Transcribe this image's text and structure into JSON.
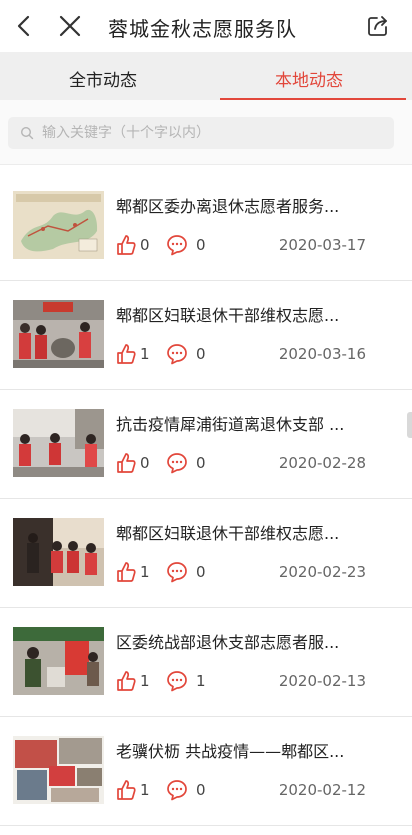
{
  "header": {
    "title": "蓉城金秋志愿服务队",
    "icons": {
      "back": "chevron-left-icon",
      "close": "close-icon",
      "share": "share-icon"
    }
  },
  "tabs": [
    {
      "label": "全市动态",
      "active": false
    },
    {
      "label": "本地动态",
      "active": true
    }
  ],
  "search": {
    "placeholder": "输入关键字（十个字以内）",
    "value": ""
  },
  "colors": {
    "accent": "#e2473b",
    "tab_bg": "#efefef",
    "search_bg": "#efefef"
  },
  "items": [
    {
      "title": "郫都区委办离退休志愿者服务...",
      "likes": "0",
      "comments": "0",
      "date": "2020-03-17",
      "thumb": "map-photo"
    },
    {
      "title": "郫都区妇联退休干部维权志愿...",
      "likes": "1",
      "comments": "0",
      "date": "2020-03-16",
      "thumb": "volunteers-photo"
    },
    {
      "title": "抗击疫情犀浦街道离退休支部 ...",
      "likes": "0",
      "comments": "0",
      "date": "2020-02-28",
      "thumb": "volunteers-street-photo"
    },
    {
      "title": "郫都区妇联退休干部维权志愿...",
      "likes": "1",
      "comments": "0",
      "date": "2020-02-23",
      "thumb": "volunteers-group-photo"
    },
    {
      "title": "区委统战部退休支部志愿者服...",
      "likes": "1",
      "comments": "1",
      "date": "2020-02-13",
      "thumb": "checkpoint-photo"
    },
    {
      "title": "老骥伏枥 共战疫情——郫都区...",
      "likes": "1",
      "comments": "0",
      "date": "2020-02-12",
      "thumb": "collage-photo"
    }
  ]
}
